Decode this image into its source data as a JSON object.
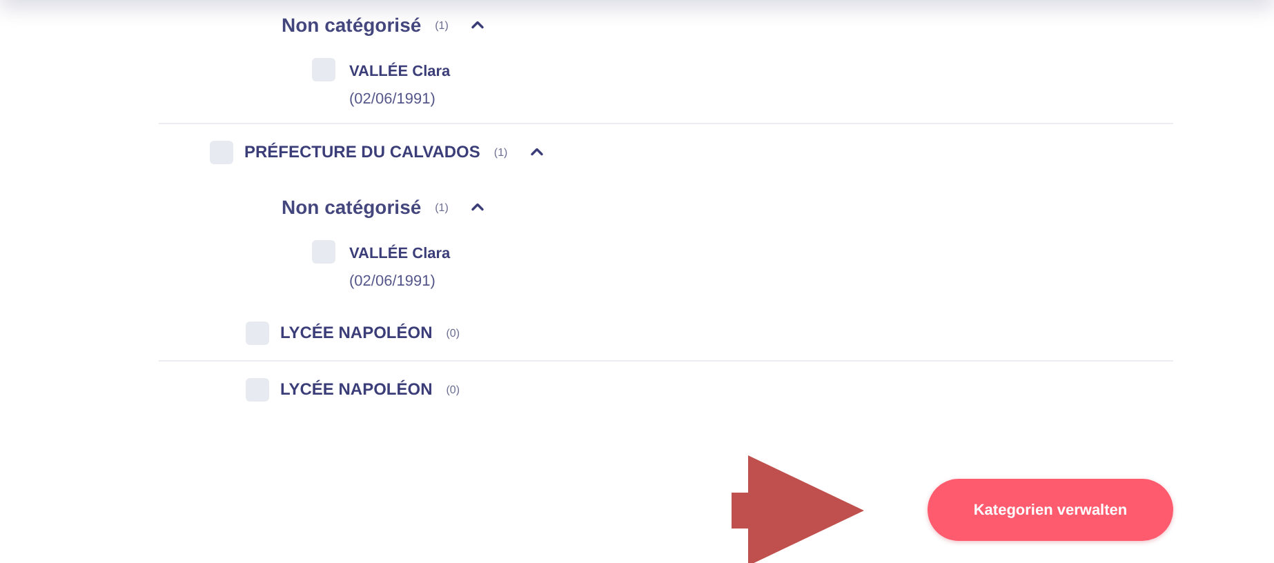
{
  "sections": [
    {
      "children": [
        {
          "kind": "category",
          "label": "Non catégorisé",
          "count": "(1)",
          "expanded": true,
          "children": [
            {
              "kind": "person",
              "name": "VALLÉE Clara",
              "detail": "(02/06/1991)",
              "checked": false
            }
          ]
        }
      ]
    },
    {
      "organization": {
        "kind": "organization",
        "label": "PRÉFECTURE DU CALVADOS",
        "count": "(1)",
        "checked": false,
        "expanded": true
      },
      "children": [
        {
          "kind": "category",
          "label": "Non catégorisé",
          "count": "(1)",
          "expanded": true,
          "children": [
            {
              "kind": "person",
              "name": "VALLÉE Clara",
              "detail": "(02/06/1991)",
              "checked": false
            }
          ]
        },
        {
          "kind": "organization",
          "label": "LYCÉE NAPOLÉON",
          "count": "(0)",
          "checked": false
        }
      ]
    },
    {
      "children": [
        {
          "kind": "organization",
          "label": "LYCÉE NAPOLÉON",
          "count": "(0)",
          "checked": false
        }
      ]
    }
  ],
  "action_button": "Kategorien verwalten"
}
